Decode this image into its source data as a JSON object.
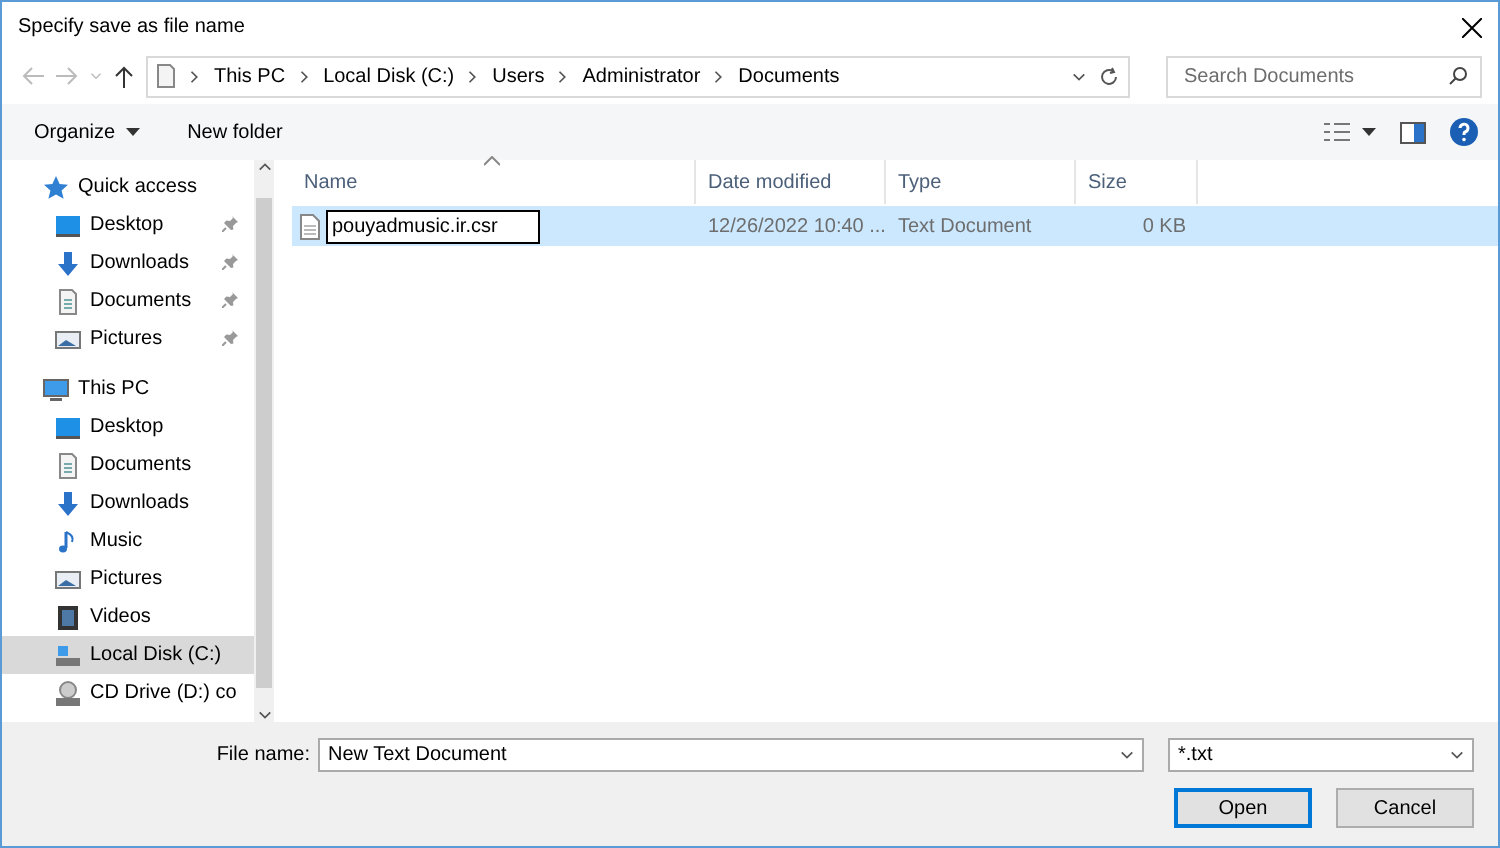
{
  "window": {
    "title": "Specify save as file name"
  },
  "address": {
    "crumbs": [
      "This PC",
      "Local Disk (C:)",
      "Users",
      "Administrator",
      "Documents"
    ],
    "search_placeholder": "Search Documents"
  },
  "toolbar": {
    "organize": "Organize",
    "new_folder": "New folder"
  },
  "sidebar": {
    "items": [
      {
        "label": "Quick access",
        "kind": "star",
        "pinned": false,
        "selected": false,
        "children": [
          {
            "label": "Desktop",
            "kind": "desktop",
            "pinned": true,
            "selected": false
          },
          {
            "label": "Downloads",
            "kind": "downloads",
            "pinned": true,
            "selected": false
          },
          {
            "label": "Documents",
            "kind": "documents",
            "pinned": true,
            "selected": false
          },
          {
            "label": "Pictures",
            "kind": "pictures",
            "pinned": true,
            "selected": false
          }
        ]
      },
      {
        "label": "This PC",
        "kind": "pc",
        "pinned": false,
        "selected": false,
        "children": [
          {
            "label": "Desktop",
            "kind": "desktop",
            "pinned": false,
            "selected": false
          },
          {
            "label": "Documents",
            "kind": "documents",
            "pinned": false,
            "selected": false
          },
          {
            "label": "Downloads",
            "kind": "downloads",
            "pinned": false,
            "selected": false
          },
          {
            "label": "Music",
            "kind": "music",
            "pinned": false,
            "selected": false
          },
          {
            "label": "Pictures",
            "kind": "pictures",
            "pinned": false,
            "selected": false
          },
          {
            "label": "Videos",
            "kind": "videos",
            "pinned": false,
            "selected": false
          },
          {
            "label": "Local Disk (C:)",
            "kind": "disk",
            "pinned": false,
            "selected": true
          },
          {
            "label": "CD Drive (D:) co",
            "kind": "cd",
            "pinned": false,
            "selected": false
          }
        ]
      }
    ]
  },
  "table": {
    "columns": [
      "Name",
      "Date modified",
      "Type",
      "Size"
    ],
    "rows": [
      {
        "name": "pouyadmusic.ir.csr",
        "renaming": true,
        "selected": true,
        "date": "12/26/2022 10:40 ...",
        "type": "Text Document",
        "size": "0 KB"
      }
    ]
  },
  "footer": {
    "file_name_label": "File name:",
    "file_name": "New Text Document",
    "file_type": "*.txt",
    "buttons": [
      "Open",
      "Cancel"
    ]
  }
}
